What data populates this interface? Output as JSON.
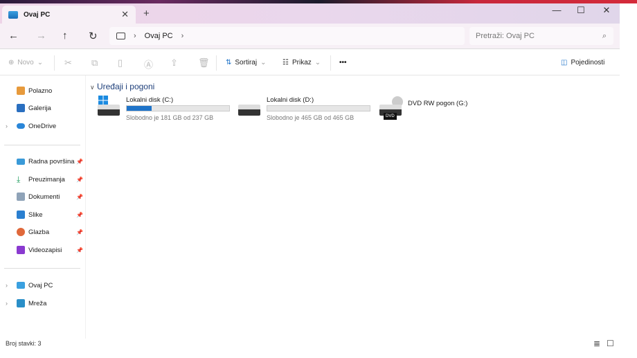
{
  "tab": {
    "title": "Ovaj PC",
    "new_tab": "+",
    "close": "✕"
  },
  "window": {
    "minimize": "—",
    "maximize": "☐",
    "close": "✕"
  },
  "nav": {
    "back": "←",
    "forward": "→",
    "up": "↑",
    "refresh": "↻",
    "breadcrumb": "Ovaj PC",
    "search_placeholder": "Pretraži: Ovaj PC"
  },
  "toolbar": {
    "new": "Novo",
    "sort": "Sortiraj",
    "view": "Prikaz",
    "more": "•••",
    "details": "Pojedinosti"
  },
  "sidebar": {
    "top": [
      "Polazno",
      "Galerija",
      "OneDrive"
    ],
    "pinned": [
      "Radna površina",
      "Preuzimanja",
      "Dokumenti",
      "Slike",
      "Glazba",
      "Videozapisi"
    ],
    "bottom": [
      "Ovaj PC",
      "Mreža"
    ]
  },
  "main": {
    "group": "Uređaji i pogoni",
    "drives": [
      {
        "name": "Lokalni disk (C:)",
        "free": "Slobodno je 181 GB od 237 GB",
        "used_fraction": 0.24
      },
      {
        "name": "Lokalni disk (D:)",
        "free": "Slobodno je 465 GB od 465 GB",
        "used_fraction": 0.0
      },
      {
        "name": "DVD RW pogon (G:)",
        "badge": "DVD"
      }
    ]
  },
  "status": {
    "count": "Broj stavki: 3"
  },
  "colors": {
    "accent": "#1f74c9"
  }
}
